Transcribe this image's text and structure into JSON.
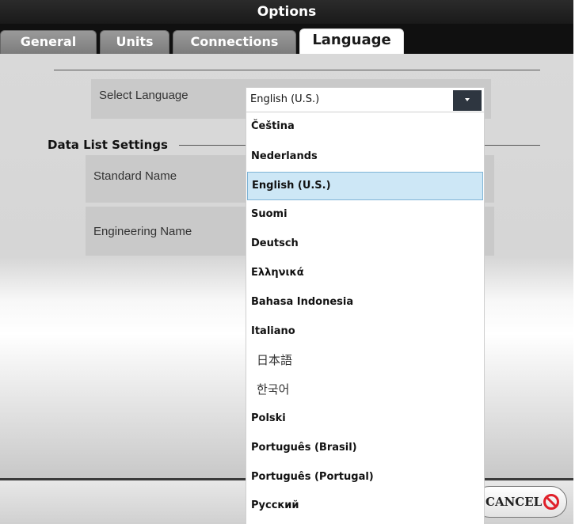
{
  "window": {
    "title": "Options"
  },
  "tabs": [
    {
      "label": "General"
    },
    {
      "label": "Units"
    },
    {
      "label": "Connections"
    },
    {
      "label": "Language"
    }
  ],
  "active_tab": "Language",
  "language_setting": {
    "label": "Select Language",
    "selected_value": "English (U.S.)"
  },
  "data_list_settings": {
    "title": "Data List Settings",
    "standard_name_label": "Standard Name",
    "engineering_name_label": "Engineering Name"
  },
  "dropdown": {
    "options": [
      "Čeština",
      "Nederlands",
      "English (U.S.)",
      "Suomi",
      "Deutsch",
      "Ελληνικά",
      "Bahasa Indonesia",
      "Italiano",
      "日本語",
      "한국어",
      "Polski",
      "Português (Brasil)",
      "Português (Portugal)",
      "Русский"
    ],
    "highlighted": "English (U.S.)"
  },
  "footer": {
    "cancel_label": "CANCEL"
  },
  "colors": {
    "title_bar": "#1f1f1f",
    "highlight": "#cde7f6",
    "cancel_icon": "#e0202a"
  }
}
